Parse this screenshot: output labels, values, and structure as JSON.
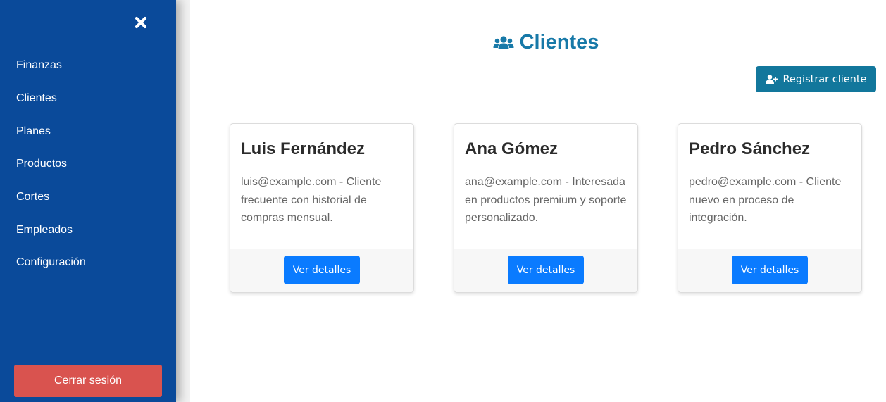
{
  "sidebar": {
    "close_icon": "close-x-icon",
    "items": [
      {
        "label": "Finanzas"
      },
      {
        "label": "Clientes"
      },
      {
        "label": "Planes"
      },
      {
        "label": "Productos"
      },
      {
        "label": "Cortes"
      },
      {
        "label": "Empleados"
      },
      {
        "label": "Configuración"
      }
    ],
    "logout_label": "Cerrar sesión"
  },
  "main": {
    "title": "Clientes",
    "title_icon": "users-icon",
    "register_label": "Registrar cliente",
    "register_icon": "user-plus-icon"
  },
  "clients": [
    {
      "name": "Luis Fernández",
      "description": "luis@example.com - Cliente frecuente con historial de compras mensual.",
      "button": "Ver detalles"
    },
    {
      "name": "Ana Gómez",
      "description": "ana@example.com - Interesada en productos premium y soporte personalizado.",
      "button": "Ver detalles"
    },
    {
      "name": "Pedro Sánchez",
      "description": "pedro@example.com - Cliente nuevo en proceso de integración.",
      "button": "Ver detalles"
    }
  ],
  "colors": {
    "sidebar": "#0a4a9a",
    "logout": "#d9534f",
    "title": "#1779a8",
    "register": "#12779c",
    "details": "#0a7bff"
  }
}
